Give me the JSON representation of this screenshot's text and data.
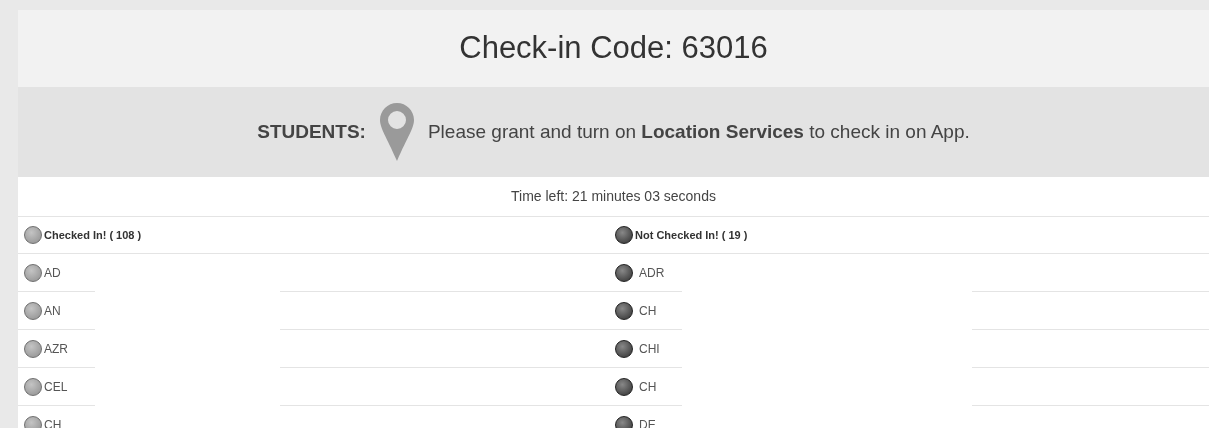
{
  "title": "Check-in Code: 63016",
  "notice": {
    "label": "STUDENTS:",
    "message": "Please grant and turn on **Location Services** to check in on App."
  },
  "time_left": "Time left: 21 minutes 03 seconds",
  "columns": [
    {
      "heading": "Checked In! ( 108 )",
      "checked": true,
      "students": [
        "AD",
        "AN",
        "AZR",
        "CEL",
        "CH"
      ]
    },
    {
      "heading": "Not Checked In! ( 19 )",
      "checked": false,
      "students": [
        "ADR",
        "CH",
        "CHI",
        "CH",
        "DE"
      ]
    }
  ]
}
